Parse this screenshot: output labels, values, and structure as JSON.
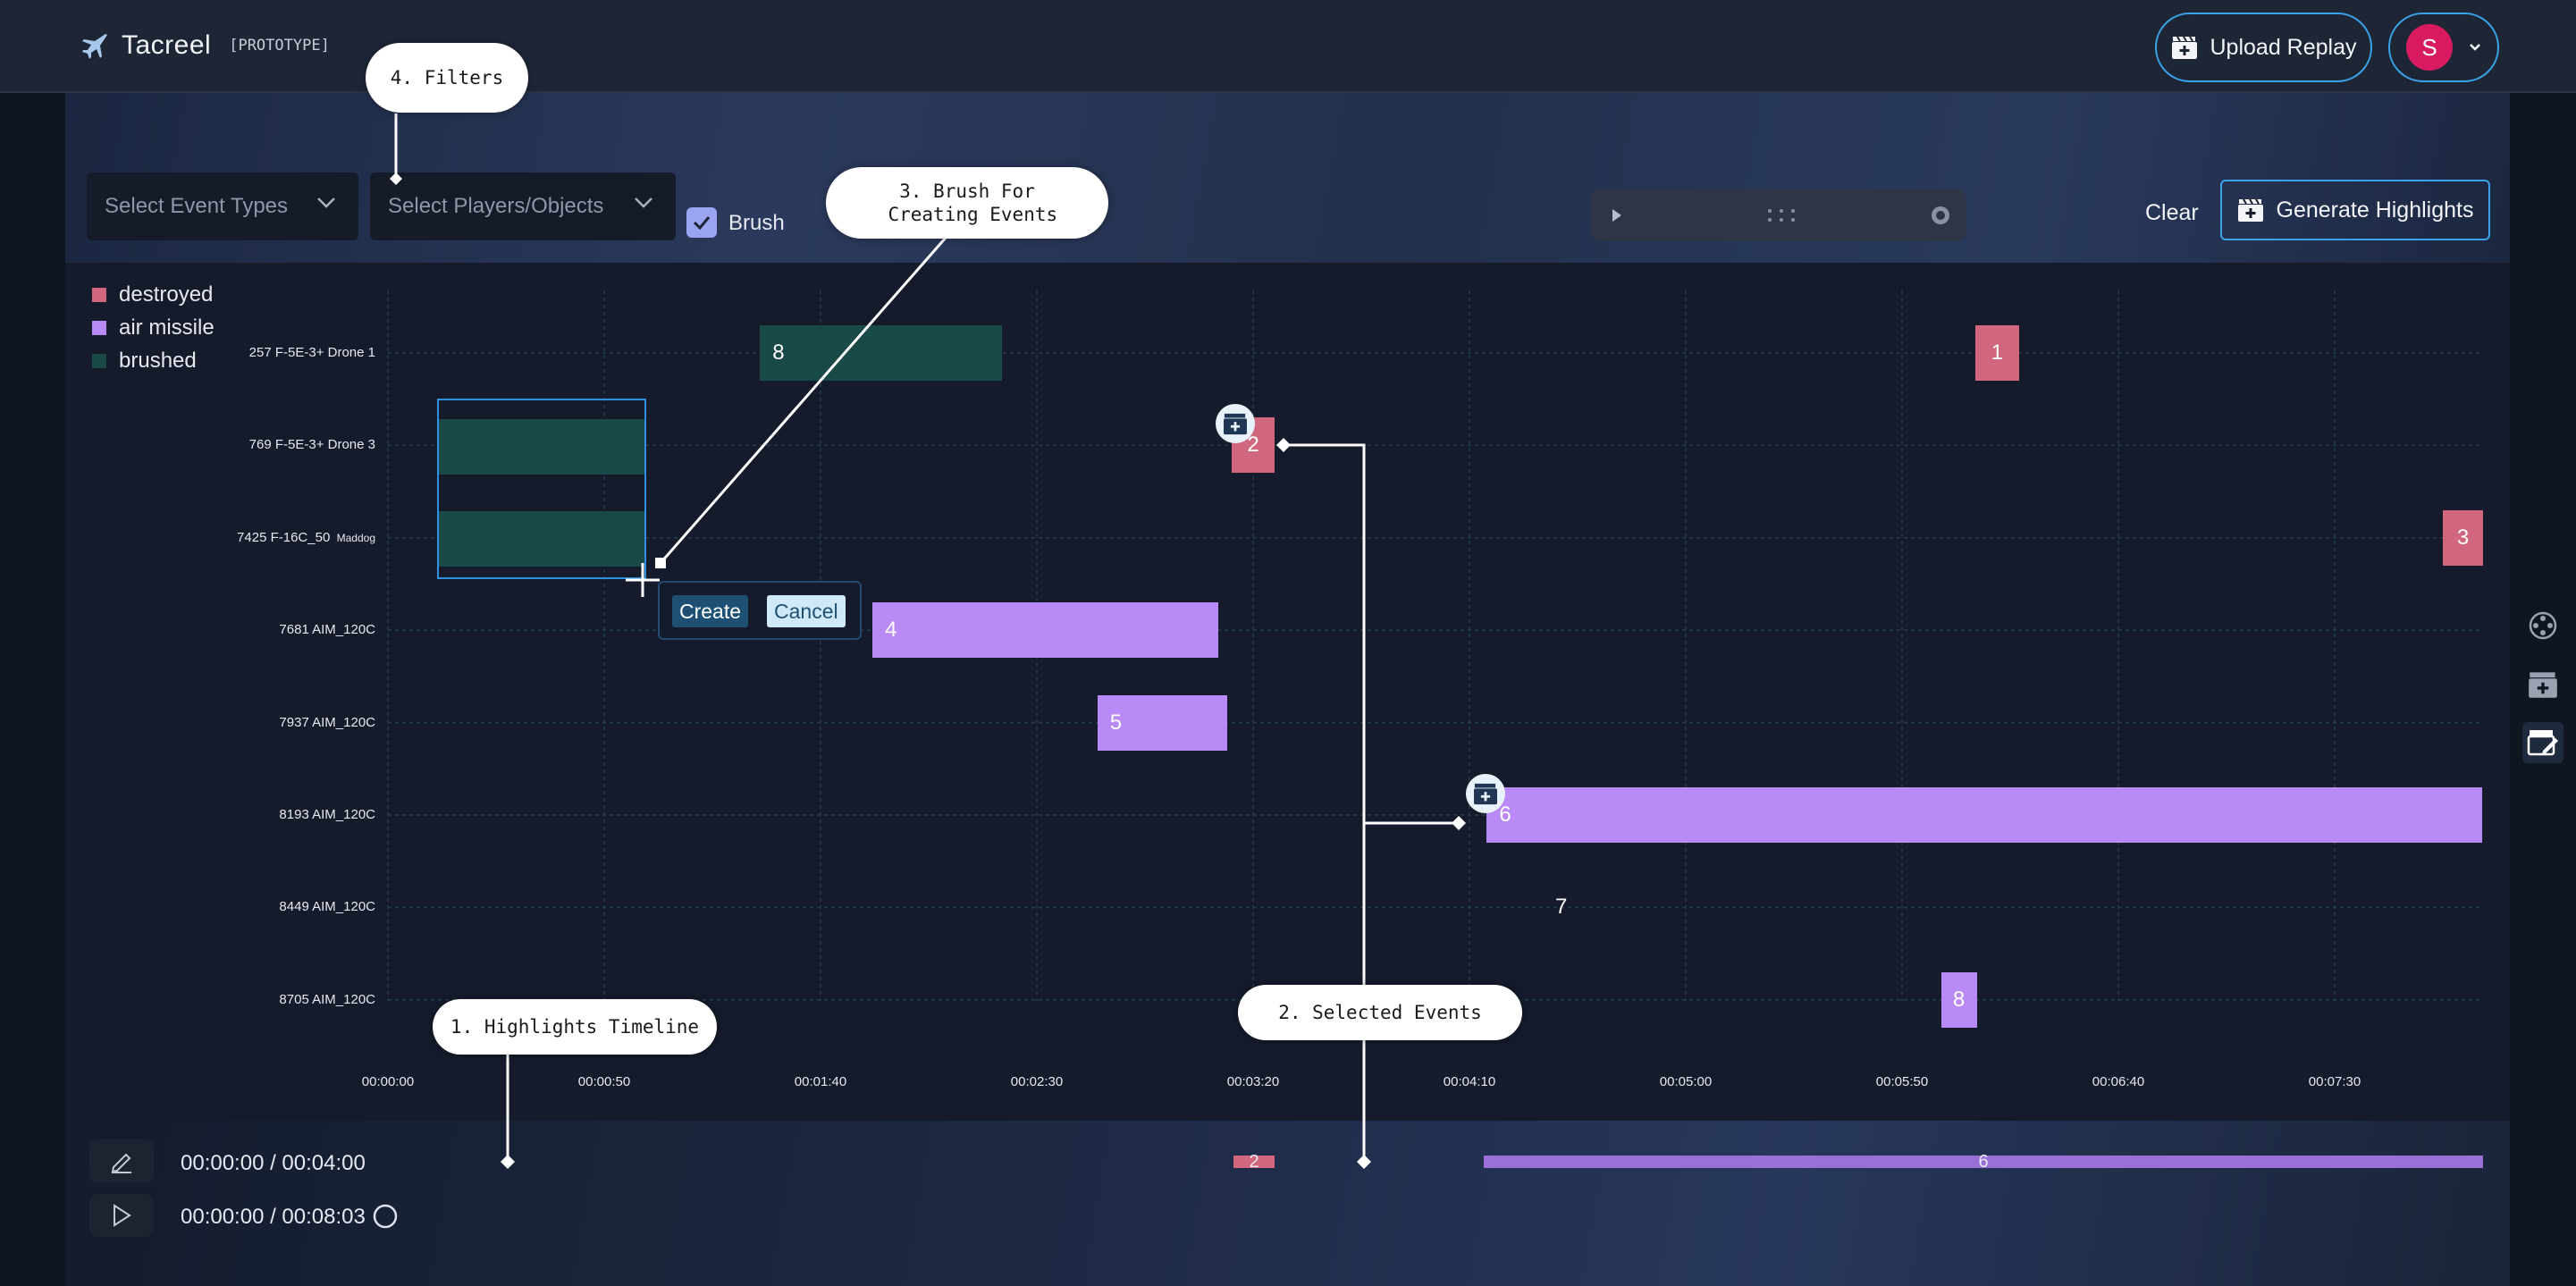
{
  "header": {
    "app_name": "Tacreel",
    "app_tag": "[PROTOTYPE]",
    "upload_label": "Upload Replay",
    "user_initial": "S"
  },
  "toolbar": {
    "event_types_placeholder": "Select Event Types",
    "players_placeholder": "Select Players/Objects",
    "brush_label": "Brush",
    "brush_checked": true,
    "clear_label": "Clear",
    "generate_label": "Generate Highlights"
  },
  "legend": [
    {
      "label": "destroyed",
      "color": "#d0677e"
    },
    {
      "label": "air missile",
      "color": "#b98af5"
    },
    {
      "label": "brushed",
      "color": "#1a4a48"
    }
  ],
  "timeline": {
    "rows": [
      {
        "main": "257 F-5E-3+ Drone 1",
        "sub": ""
      },
      {
        "main": "769 F-5E-3+ Drone 3",
        "sub": ""
      },
      {
        "main": "7425 F-16C_50",
        "sub": "Maddog"
      },
      {
        "main": "7681 AIM_120C",
        "sub": ""
      },
      {
        "main": "7937 AIM_120C",
        "sub": ""
      },
      {
        "main": "8193 AIM_120C",
        "sub": ""
      },
      {
        "main": "8449 AIM_120C",
        "sub": ""
      },
      {
        "main": "8705 AIM_120C",
        "sub": ""
      }
    ],
    "x_ticks": [
      "00:00:00",
      "00:00:50",
      "00:01:40",
      "00:02:30",
      "00:03:20",
      "00:04:10",
      "00:05:00",
      "00:05:50",
      "00:06:40",
      "00:07:30"
    ],
    "x_range_seconds": [
      0,
      483
    ],
    "events": [
      {
        "label": "8",
        "row": 0,
        "start_s": 86,
        "end_s": 142,
        "kind": "brushed"
      },
      {
        "label": "1",
        "row": 0,
        "start_s": 367,
        "end_s": 377,
        "kind": "destroyed"
      },
      {
        "label": "2",
        "row": 1,
        "start_s": 195,
        "end_s": 205,
        "kind": "destroyed"
      },
      {
        "label": "3",
        "row": 2,
        "start_s": 475,
        "end_s": 485,
        "kind": "destroyed"
      },
      {
        "label": "4",
        "row": 3,
        "start_s": 112,
        "end_s": 192,
        "kind": "air missile"
      },
      {
        "label": "5",
        "row": 4,
        "start_s": 164,
        "end_s": 194,
        "kind": "air missile"
      },
      {
        "label": "6",
        "row": 5,
        "start_s": 254,
        "end_s": 484,
        "kind": "air missile"
      },
      {
        "label": "7",
        "row": 6,
        "start_s": 269,
        "end_s": 269,
        "kind": "text"
      },
      {
        "label": "8",
        "row": 7,
        "start_s": 359,
        "end_s": 367,
        "kind": "air missile"
      }
    ],
    "brush_popup": {
      "create": "Create",
      "cancel": "Cancel"
    }
  },
  "highlights": {
    "time_edit": "00:00:00 / 00:04:00",
    "time_play": "00:00:00 / 00:08:03",
    "segments": [
      {
        "label": "2"
      },
      {
        "label": "6"
      }
    ]
  },
  "callouts": {
    "c1": "1. Highlights Timeline",
    "c2": "2. Selected Events",
    "c3": "3. Brush For\n Creating Events",
    "c4": "4. Filters"
  },
  "side_icons": [
    "reel-icon",
    "clapper-icon",
    "clapper-edit-icon"
  ]
}
